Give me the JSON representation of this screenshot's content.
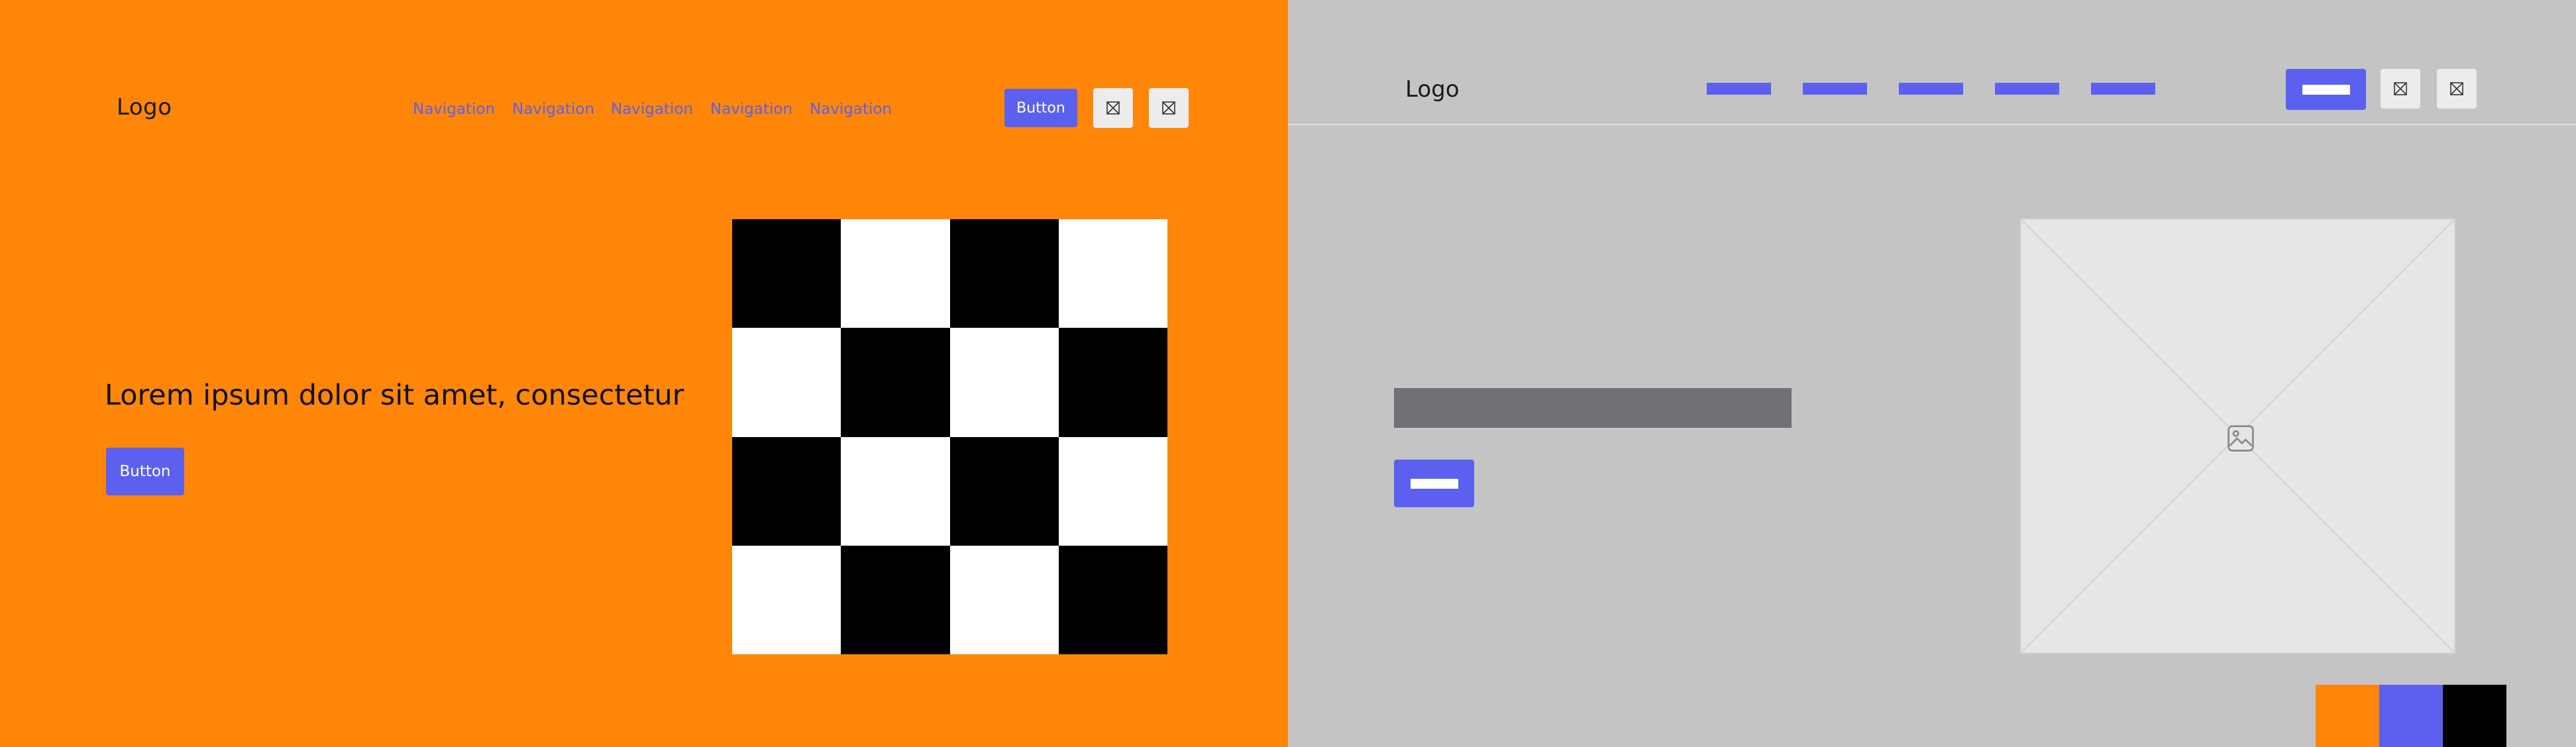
{
  "hifi": {
    "logo": "Logo",
    "nav": [
      "Navigation",
      "Navigation",
      "Navigation",
      "Navigation",
      "Navigation"
    ],
    "header_button": "Button",
    "header_icons": [
      "placeholder-icon",
      "placeholder-icon"
    ],
    "hero": {
      "headline": "Lorem ipsum dolor sit amet, consectetur",
      "button": "Button"
    },
    "checkerboard_pattern": [
      "black",
      "white",
      "black",
      "white",
      "white",
      "black",
      "white",
      "black",
      "black",
      "white",
      "black",
      "white",
      "white",
      "black",
      "white",
      "black"
    ]
  },
  "wireframe": {
    "logo": "Logo",
    "header_icons": [
      "placeholder-icon",
      "placeholder-icon"
    ],
    "image_icon": "image-icon"
  },
  "palette": {
    "orange": "#ff8608",
    "blue": "#5b61ee",
    "black": "#000000",
    "wireframe_gray": "#c4c4c4",
    "placeholder_bar": "#717074"
  }
}
